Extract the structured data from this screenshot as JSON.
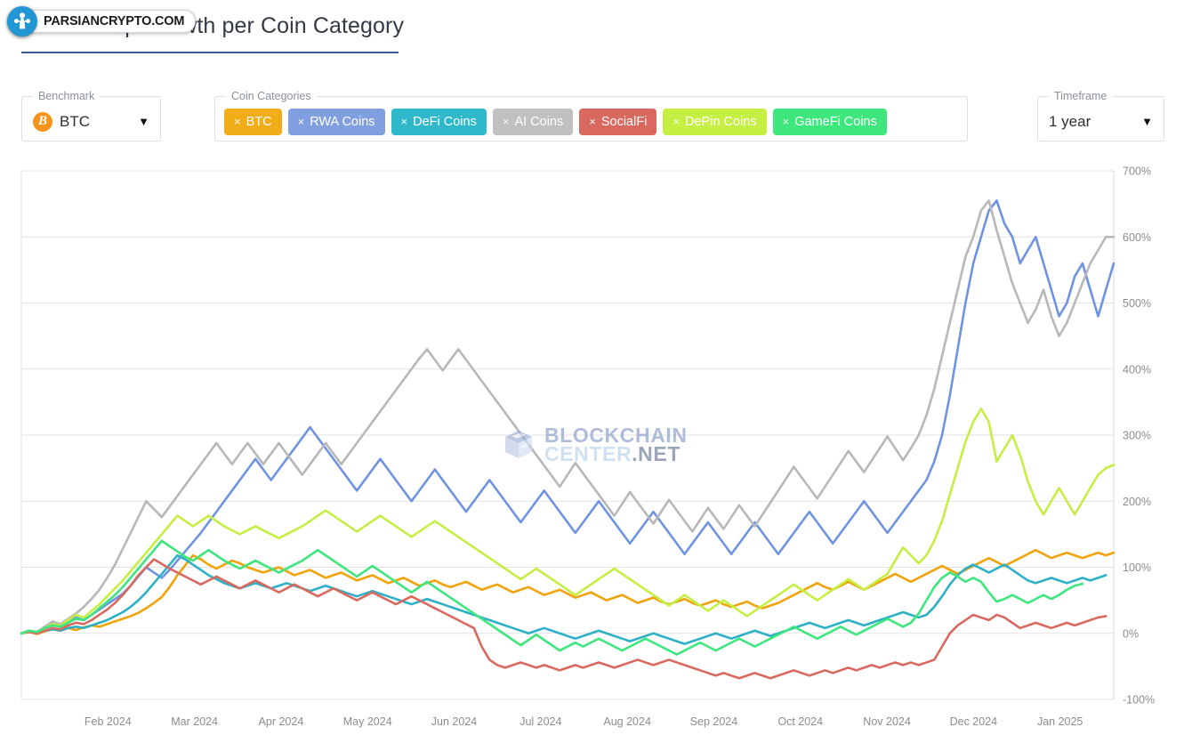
{
  "brand": {
    "name": "PARSIANCRYPTO.COM",
    "logo_icon": "network-tree-icon",
    "accent": "#2196d3"
  },
  "header": {
    "title": "Market Cap Growth per Coin Category",
    "rule_color": "#3a5a9b"
  },
  "controls": {
    "benchmark": {
      "legend": "Benchmark",
      "value": "BTC",
      "coin_icon": "bitcoin-icon",
      "caret_icon": "chevron-down-icon"
    },
    "timeframe": {
      "legend": "Timeframe",
      "value": "1 year",
      "caret_icon": "chevron-down-icon"
    },
    "categories": {
      "legend": "Coin Categories",
      "remove_icon": "close-x-icon",
      "chips": [
        {
          "label": "BTC",
          "color": "#f0ad17"
        },
        {
          "label": "RWA Coins",
          "color": "#7f9fe0"
        },
        {
          "label": "DeFi Coins",
          "color": "#2eb8c9"
        },
        {
          "label": "AI Coins",
          "color": "#c0c0c0"
        },
        {
          "label": "SocialFi",
          "color": "#d9695f"
        },
        {
          "label": "DePin Coins",
          "color": "#c5ef43"
        },
        {
          "label": "GameFi Coins",
          "color": "#3ee67e"
        }
      ]
    }
  },
  "watermark": {
    "icon": "cube-logo-icon",
    "line1": "BLOCKCHAIN",
    "line2_light": "CENTER",
    "line2_dark": ".NET"
  },
  "chart_data": {
    "type": "line",
    "title": "Market Cap Growth per Coin Category",
    "xlabel": "",
    "ylabel": "",
    "grid": true,
    "legend_position": "none",
    "y_tick_labels": [
      "700%",
      "600%",
      "500%",
      "400%",
      "300%",
      "200%",
      "100%",
      "0%",
      "-100%"
    ],
    "ylim": [
      -100,
      700
    ],
    "y_ticks": [
      700,
      600,
      500,
      400,
      300,
      200,
      100,
      0,
      -100
    ],
    "x_tick_labels": [
      "Feb 2024",
      "Mar 2024",
      "Apr 2024",
      "May 2024",
      "Jun 2024",
      "Jul 2024",
      "Aug 2024",
      "Sep 2024",
      "Oct 2024",
      "Nov 2024",
      "Dec 2024",
      "Jan 2025"
    ],
    "x_start": "Jan 2024",
    "x_end": "Jan 2025",
    "series": [
      {
        "name": "BTC",
        "color": "#f0a30a",
        "values": [
          0,
          2,
          -1,
          3,
          6,
          4,
          8,
          5,
          9,
          12,
          10,
          14,
          18,
          22,
          26,
          31,
          38,
          46,
          55,
          70,
          88,
          103,
          118,
          112,
          104,
          98,
          104,
          110,
          106,
          100,
          96,
          92,
          96,
          100,
          94,
          88,
          92,
          96,
          90,
          84,
          88,
          92,
          86,
          80,
          84,
          88,
          82,
          76,
          80,
          84,
          78,
          72,
          76,
          80,
          74,
          70,
          74,
          78,
          72,
          66,
          70,
          74,
          68,
          62,
          66,
          70,
          64,
          58,
          62,
          66,
          60,
          54,
          58,
          62,
          56,
          50,
          54,
          58,
          52,
          46,
          50,
          54,
          48,
          44,
          48,
          52,
          46,
          42,
          46,
          50,
          44,
          40,
          44,
          48,
          42,
          38,
          42,
          46,
          52,
          58,
          64,
          70,
          76,
          70,
          66,
          72,
          78,
          72,
          66,
          72,
          78,
          84,
          90,
          84,
          78,
          84,
          90,
          96,
          102,
          96,
          90,
          96,
          102,
          108,
          114,
          108,
          102,
          108,
          114,
          120,
          126,
          120,
          114,
          118,
          122,
          118,
          114,
          118,
          122,
          118,
          122
        ]
      },
      {
        "name": "RWA Coins",
        "color": "#6f93e3",
        "values": [
          0,
          4,
          2,
          8,
          14,
          10,
          18,
          24,
          20,
          28,
          36,
          44,
          52,
          60,
          72,
          86,
          100,
          92,
          84,
          96,
          110,
          124,
          138,
          152,
          168,
          184,
          200,
          216,
          232,
          248,
          264,
          248,
          232,
          248,
          264,
          280,
          296,
          312,
          296,
          280,
          264,
          248,
          232,
          216,
          232,
          248,
          264,
          248,
          232,
          216,
          200,
          216,
          232,
          248,
          232,
          216,
          200,
          184,
          200,
          216,
          232,
          216,
          200,
          184,
          168,
          184,
          200,
          216,
          200,
          184,
          168,
          152,
          168,
          184,
          200,
          184,
          168,
          152,
          136,
          152,
          168,
          184,
          168,
          152,
          136,
          120,
          136,
          152,
          168,
          152,
          136,
          120,
          136,
          152,
          168,
          152,
          136,
          120,
          136,
          152,
          168,
          184,
          168,
          152,
          136,
          152,
          168,
          184,
          200,
          184,
          168,
          152,
          168,
          184,
          200,
          216,
          232,
          260,
          300,
          360,
          430,
          500,
          560,
          600,
          640,
          655,
          620,
          600,
          560,
          580,
          600,
          560,
          520,
          480,
          500,
          540,
          560,
          520,
          480,
          520,
          560
        ]
      },
      {
        "name": "DeFi Coins",
        "color": "#2eb0c7",
        "values": [
          0,
          2,
          0,
          4,
          6,
          4,
          8,
          10,
          8,
          12,
          16,
          20,
          26,
          32,
          40,
          50,
          62,
          76,
          90,
          104,
          118,
          112,
          104,
          96,
          88,
          82,
          76,
          72,
          68,
          72,
          76,
          72,
          68,
          72,
          76,
          72,
          68,
          64,
          68,
          72,
          68,
          64,
          60,
          56,
          60,
          64,
          60,
          56,
          52,
          48,
          44,
          48,
          52,
          48,
          44,
          40,
          36,
          32,
          28,
          24,
          20,
          16,
          12,
          8,
          4,
          0,
          4,
          8,
          4,
          0,
          -4,
          -8,
          -4,
          0,
          4,
          0,
          -4,
          -8,
          -12,
          -8,
          -4,
          0,
          -4,
          -8,
          -12,
          -16,
          -12,
          -8,
          -4,
          0,
          -4,
          -8,
          -4,
          0,
          4,
          0,
          -4,
          0,
          4,
          8,
          12,
          16,
          12,
          8,
          12,
          16,
          20,
          16,
          12,
          16,
          20,
          24,
          28,
          32,
          28,
          24,
          28,
          40,
          56,
          74,
          88,
          98,
          104,
          98,
          92,
          98,
          104,
          96,
          88,
          80,
          76,
          80,
          84,
          80,
          76,
          80,
          84,
          80,
          84,
          88
        ]
      },
      {
        "name": "AI Coins",
        "color": "#b8b8b8",
        "values": [
          0,
          4,
          2,
          10,
          18,
          14,
          22,
          30,
          40,
          52,
          66,
          84,
          104,
          128,
          152,
          176,
          200,
          188,
          176,
          192,
          208,
          224,
          240,
          256,
          272,
          288,
          272,
          256,
          272,
          288,
          272,
          256,
          272,
          288,
          272,
          256,
          240,
          256,
          272,
          288,
          272,
          256,
          272,
          288,
          304,
          320,
          336,
          352,
          368,
          384,
          400,
          416,
          430,
          414,
          398,
          414,
          430,
          414,
          398,
          382,
          366,
          350,
          334,
          318,
          302,
          286,
          270,
          254,
          238,
          222,
          240,
          258,
          242,
          226,
          210,
          194,
          178,
          196,
          214,
          198,
          182,
          166,
          184,
          202,
          186,
          170,
          154,
          172,
          190,
          174,
          158,
          176,
          194,
          178,
          162,
          180,
          198,
          216,
          234,
          252,
          236,
          220,
          204,
          222,
          240,
          258,
          276,
          260,
          244,
          262,
          280,
          298,
          280,
          262,
          280,
          300,
          330,
          370,
          420,
          470,
          520,
          570,
          600,
          640,
          655,
          610,
          570,
          530,
          500,
          470,
          490,
          520,
          480,
          450,
          470,
          500,
          530,
          560,
          580,
          600,
          600
        ]
      },
      {
        "name": "SocialFi",
        "color": "#d9695f",
        "values": [
          0,
          2,
          0,
          4,
          8,
          6,
          12,
          16,
          14,
          20,
          28,
          36,
          46,
          58,
          72,
          88,
          100,
          112,
          105,
          98,
          92,
          86,
          80,
          74,
          80,
          86,
          80,
          74,
          68,
          74,
          80,
          74,
          68,
          62,
          68,
          74,
          68,
          62,
          56,
          62,
          68,
          62,
          56,
          50,
          56,
          62,
          56,
          50,
          44,
          50,
          56,
          50,
          44,
          38,
          32,
          26,
          20,
          14,
          8,
          -20,
          -40,
          -48,
          -52,
          -48,
          -44,
          -48,
          -52,
          -48,
          -52,
          -56,
          -52,
          -48,
          -52,
          -48,
          -44,
          -48,
          -52,
          -48,
          -44,
          -40,
          -44,
          -48,
          -44,
          -40,
          -44,
          -48,
          -52,
          -56,
          -60,
          -64,
          -60,
          -64,
          -68,
          -64,
          -60,
          -64,
          -68,
          -64,
          -60,
          -56,
          -60,
          -64,
          -60,
          -56,
          -60,
          -56,
          -52,
          -56,
          -52,
          -48,
          -52,
          -48,
          -44,
          -48,
          -44,
          -48,
          -44,
          -40,
          -20,
          0,
          12,
          20,
          28,
          24,
          20,
          28,
          24,
          16,
          8,
          12,
          16,
          12,
          8,
          12,
          16,
          12,
          16,
          20,
          24,
          26
        ]
      },
      {
        "name": "DePin Coins",
        "color": "#c5ef43",
        "values": [
          0,
          4,
          2,
          8,
          14,
          12,
          20,
          28,
          24,
          34,
          44,
          56,
          68,
          80,
          94,
          108,
          122,
          136,
          150,
          164,
          178,
          170,
          162,
          170,
          178,
          170,
          162,
          156,
          150,
          156,
          162,
          156,
          150,
          144,
          150,
          156,
          162,
          170,
          178,
          186,
          178,
          170,
          162,
          154,
          162,
          170,
          178,
          170,
          162,
          154,
          146,
          154,
          162,
          170,
          162,
          154,
          146,
          138,
          130,
          122,
          114,
          106,
          98,
          90,
          82,
          90,
          98,
          90,
          82,
          74,
          66,
          58,
          66,
          74,
          82,
          90,
          98,
          90,
          82,
          74,
          66,
          58,
          50,
          42,
          50,
          58,
          50,
          42,
          34,
          42,
          50,
          42,
          34,
          26,
          34,
          42,
          50,
          58,
          66,
          74,
          66,
          58,
          50,
          58,
          66,
          74,
          82,
          74,
          66,
          74,
          82,
          90,
          110,
          130,
          118,
          106,
          118,
          140,
          170,
          210,
          250,
          290,
          320,
          340,
          320,
          260,
          280,
          300,
          270,
          230,
          200,
          180,
          200,
          220,
          200,
          180,
          200,
          220,
          240,
          250,
          255
        ]
      },
      {
        "name": "GameFi Coins",
        "color": "#3ee67e",
        "values": [
          0,
          4,
          2,
          8,
          12,
          10,
          16,
          22,
          20,
          28,
          38,
          48,
          58,
          70,
          84,
          98,
          112,
          126,
          140,
          132,
          124,
          116,
          110,
          118,
          126,
          118,
          110,
          104,
          98,
          104,
          110,
          104,
          98,
          92,
          98,
          104,
          110,
          118,
          126,
          118,
          110,
          102,
          94,
          86,
          94,
          102,
          94,
          86,
          78,
          70,
          62,
          70,
          78,
          70,
          62,
          54,
          46,
          38,
          30,
          22,
          14,
          6,
          -2,
          -10,
          -18,
          -10,
          -2,
          -10,
          -18,
          -26,
          -20,
          -14,
          -20,
          -14,
          -8,
          -14,
          -20,
          -26,
          -20,
          -14,
          -8,
          -14,
          -20,
          -26,
          -32,
          -26,
          -20,
          -14,
          -20,
          -26,
          -20,
          -14,
          -8,
          -14,
          -20,
          -14,
          -8,
          -2,
          4,
          10,
          4,
          -2,
          -8,
          -2,
          4,
          10,
          4,
          -2,
          4,
          10,
          16,
          22,
          16,
          10,
          16,
          30,
          50,
          70,
          84,
          92,
          86,
          78,
          84,
          78,
          62,
          48,
          52,
          58,
          52,
          46,
          52,
          58,
          52,
          58,
          66,
          72,
          75
        ]
      }
    ]
  }
}
